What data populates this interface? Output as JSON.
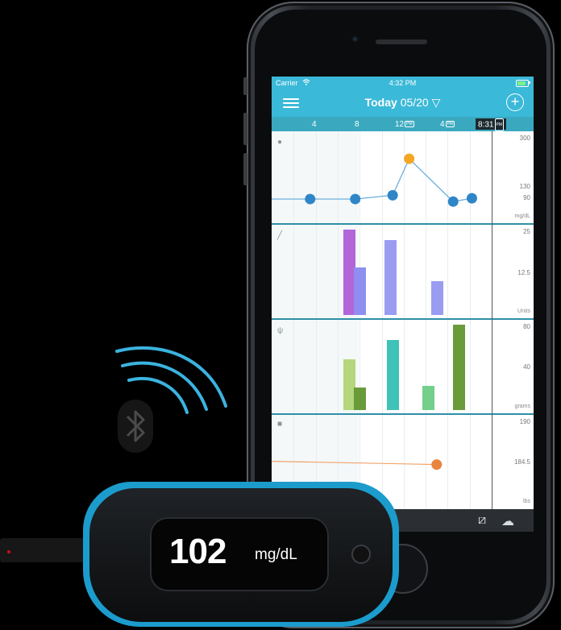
{
  "status": {
    "carrier": "Carrier",
    "time": "4:32 PM"
  },
  "nav": {
    "title_day": "Today",
    "title_date": "05/20",
    "dropdown_glyph": "▽",
    "add_glyph": "+"
  },
  "timeline": {
    "ticks": [
      "4",
      "8",
      "12",
      "4"
    ],
    "pm_badge": "PM",
    "now_time": "8:31"
  },
  "glucose_panel": {
    "y_labels": [
      "300",
      "130",
      "90"
    ],
    "unit": "mg/dL",
    "icon": "drop-icon",
    "points": [
      {
        "hour": 3.5,
        "value": 95
      },
      {
        "hour": 7.6,
        "value": 95
      },
      {
        "hour": 11.0,
        "value": 110
      },
      {
        "hour": 12.5,
        "value": 255,
        "highlight": true
      },
      {
        "hour": 16.5,
        "value": 85
      },
      {
        "hour": 18.2,
        "value": 98
      }
    ],
    "colors": {
      "line": "#5fa8d9",
      "point": "#2f86c7",
      "highlight": "#f5a623"
    }
  },
  "insulin_panel": {
    "y_labels": [
      "25",
      "12.5"
    ],
    "unit": "Units",
    "icon": "syringe-icon",
    "bars": [
      {
        "hour": 7.0,
        "value": 25,
        "color": "#b266d9"
      },
      {
        "hour": 8.0,
        "value": 14,
        "color": "#8e8ff0"
      },
      {
        "hour": 10.8,
        "value": 22,
        "color": "#9a9cf2"
      },
      {
        "hour": 15.0,
        "value": 10,
        "color": "#9a9cf2"
      }
    ]
  },
  "carbs_panel": {
    "y_labels": [
      "80",
      "40"
    ],
    "unit": "grams",
    "icon": "fork-knife-icon",
    "bars": [
      {
        "hour": 7.0,
        "value": 50,
        "color": "#b4d77b"
      },
      {
        "hour": 8.0,
        "value": 22,
        "color": "#6a9b3b"
      },
      {
        "hour": 11.0,
        "value": 69,
        "color": "#3fc2b7"
      },
      {
        "hour": 14.2,
        "value": 24,
        "color": "#72d08a"
      },
      {
        "hour": 17.0,
        "value": 84,
        "color": "#6a9b3b"
      }
    ]
  },
  "weight_panel": {
    "y_labels": [
      "190",
      "184.5"
    ],
    "unit": "lbs",
    "icon": "scale-icon",
    "points": [
      {
        "hour": 0,
        "value": 184.8
      },
      {
        "hour": 15.0,
        "value": 184.3,
        "highlight": true
      }
    ],
    "colors": {
      "line": "#f0a36a",
      "point": "#e8843e"
    }
  },
  "meter": {
    "reading": "102",
    "unit": "mg/dL",
    "accent": "#1b9ccc"
  },
  "icons": {
    "bluetooth": "bluetooth-icon",
    "strip": "test-strip-icon",
    "cloud": "cloud-icon"
  }
}
